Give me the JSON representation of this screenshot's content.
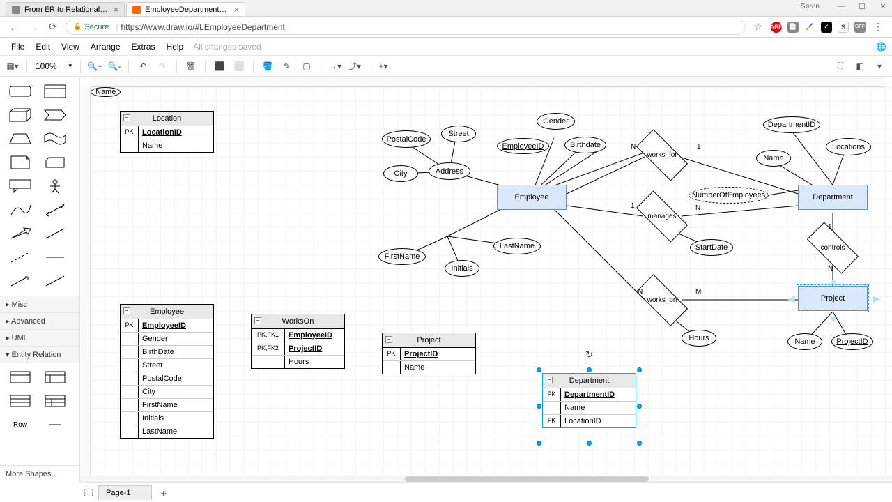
{
  "browser": {
    "tabs": [
      {
        "title": "From ER to Relational M…",
        "active": false
      },
      {
        "title": "EmployeeDepartment - c",
        "active": true
      }
    ],
    "user": "Søren",
    "secure_label": "Secure",
    "url": "https://www.draw.io/#LEmployeeDepartment",
    "ext_icons": [
      "star",
      "ABP",
      "pdf",
      "brush",
      "check",
      "S",
      "OFF",
      "menu"
    ]
  },
  "menu": {
    "items": [
      "File",
      "Edit",
      "View",
      "Arrange",
      "Extras",
      "Help"
    ],
    "status": "All changes saved"
  },
  "toolbar": {
    "zoom": "100%",
    "groups": [
      [
        "view-dd"
      ],
      [
        "zoom-in",
        "zoom-out"
      ],
      [
        "undo",
        "redo"
      ],
      [
        "delete"
      ],
      [
        "to-front",
        "to-back"
      ],
      [
        "fill",
        "stroke",
        "shadow"
      ],
      [
        "arrow-dd",
        "waypoint-dd"
      ],
      [
        "add-dd"
      ]
    ],
    "right": [
      "fullscreen",
      "format-panel",
      "collapse"
    ]
  },
  "sidebar": {
    "shape_rows": 9,
    "categories": [
      "Misc",
      "Advanced",
      "UML",
      "Entity Relation"
    ],
    "er_row_label": "Row",
    "more": "More Shapes..."
  },
  "er_tables": {
    "location": {
      "title": "Location",
      "rows": [
        {
          "key": "PK",
          "field": "LocationID",
          "pk": true
        },
        {
          "key": "",
          "field": "Name"
        }
      ]
    },
    "employee": {
      "title": "Employee",
      "rows": [
        {
          "key": "PK",
          "field": "EmployeeID",
          "pk": true
        },
        {
          "key": "",
          "field": "Gender"
        },
        {
          "key": "",
          "field": "BirthDate"
        },
        {
          "key": "",
          "field": "Street"
        },
        {
          "key": "",
          "field": "PostalCode"
        },
        {
          "key": "",
          "field": "City"
        },
        {
          "key": "",
          "field": "FirstName"
        },
        {
          "key": "",
          "field": "Initials"
        },
        {
          "key": "",
          "field": "LastName"
        }
      ]
    },
    "workson": {
      "title": "WorksOn",
      "rows": [
        {
          "key": "PK,FK1",
          "field": "EmployeeID",
          "pk": true
        },
        {
          "key": "PK,FK2",
          "field": "ProjectID",
          "pk": true
        },
        {
          "key": "",
          "field": "Hours"
        }
      ]
    },
    "project": {
      "title": "Project",
      "rows": [
        {
          "key": "PK",
          "field": "ProjectID",
          "pk": true
        },
        {
          "key": "",
          "field": "Name"
        }
      ]
    },
    "department": {
      "title": "Department",
      "rows": [
        {
          "key": "PK",
          "field": "DepartmentID",
          "pk": true
        },
        {
          "key": "",
          "field": "Name"
        },
        {
          "key": "FK",
          "field": "LocationID"
        }
      ]
    }
  },
  "er_diagram": {
    "entities": {
      "employee": "Employee",
      "department": "Department",
      "project": "Project"
    },
    "attributes": {
      "postalcode": "PostalCode",
      "street": "Street",
      "city": "City",
      "address": "Address",
      "gender": "Gender",
      "birthdate": "Birthdate",
      "employeeid": "EmployeeID",
      "firstname": "FirstName",
      "initials": "Initials",
      "lastname": "LastName",
      "name_emp": "Name",
      "departmentid": "DepartmentID",
      "locations": "Locations",
      "name_dept": "Name",
      "numberofemployees": "NumberOfEmployees",
      "startdate": "StartDate",
      "hours": "Hours",
      "name_proj": "Name",
      "projectid": "ProjectID"
    },
    "relationships": {
      "works_for": "works_for",
      "manages": "manages",
      "controls": "controls",
      "works_on": "works_on"
    },
    "cardinalities": {
      "wf_emp": "N",
      "wf_dept": "1",
      "mg_emp": "1",
      "mg_dept": "N",
      "ct_dept": "1",
      "ct_proj": "N",
      "wo_emp": "N",
      "wo_proj": "M"
    }
  },
  "footer": {
    "page": "Page-1",
    "add": "+"
  }
}
